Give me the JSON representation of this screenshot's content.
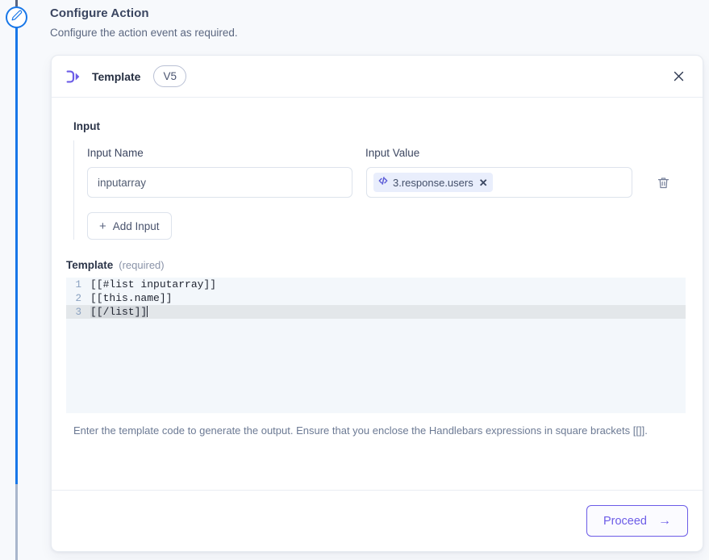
{
  "page": {
    "title": "Configure Action",
    "subtitle": "Configure the action event as required."
  },
  "timeline": {
    "node_icon": "pencil-icon",
    "accent_color": "#1877e8"
  },
  "card": {
    "header": {
      "icon": "template-branch-icon",
      "label": "Template",
      "version_badge": "V5",
      "close_icon": "close-icon"
    },
    "input_section": {
      "section_label": "Input",
      "name_column_label": "Input Name",
      "value_column_label": "Input Value",
      "input_name_value": "inputarray",
      "input_name_placeholder": "Input Name",
      "value_chip": {
        "icon": "code-icon",
        "text": "3.response.users",
        "remove_icon": "close-icon"
      },
      "delete_icon": "trash-icon",
      "add_input_label": "Add Input",
      "add_input_icon": "plus-icon"
    },
    "template_section": {
      "label": "Template",
      "required_note": "(required)",
      "code_lines": [
        {
          "number": "1",
          "text": "[[#list inputarray]]",
          "active": false
        },
        {
          "number": "2",
          "text": "[[this.name]]",
          "active": false
        },
        {
          "number": "3",
          "text": "[[/list]]",
          "active": true
        }
      ],
      "help_text": "Enter the template code to generate the output. Ensure that you enclose the Handlebars expressions in square brackets [[]]."
    },
    "footer": {
      "proceed_label": "Proceed",
      "proceed_icon": "arrow-right-icon",
      "proceed_color": "#6c5ce7"
    }
  }
}
